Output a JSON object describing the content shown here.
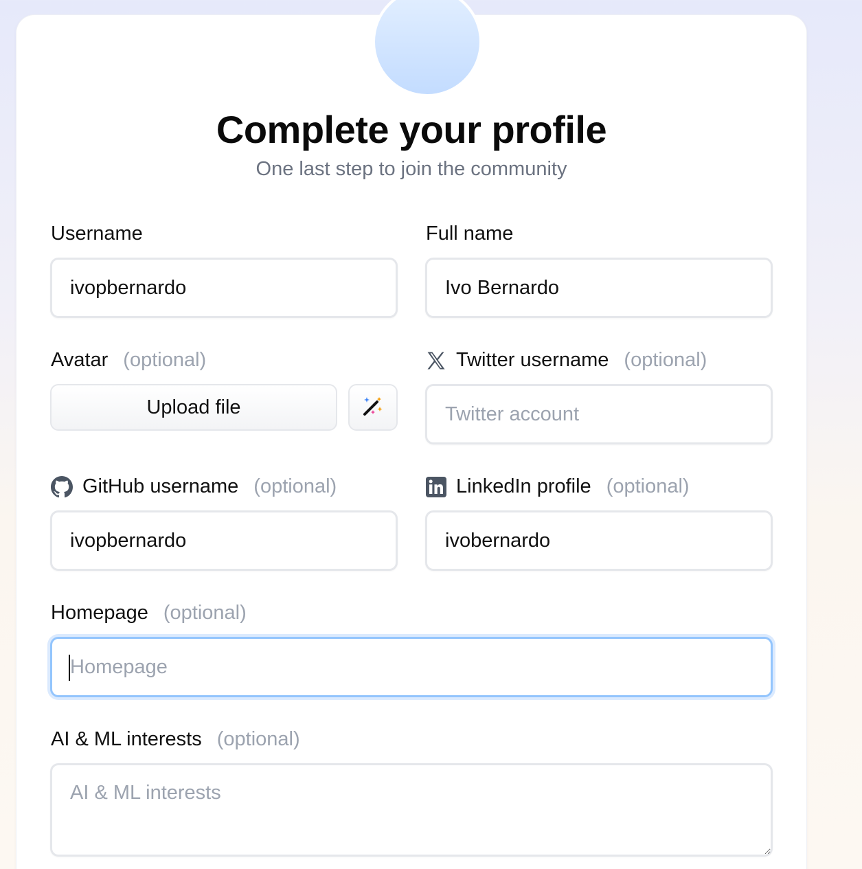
{
  "header": {
    "title": "Complete your profile",
    "subtitle": "One last step to join the community"
  },
  "form": {
    "optional_tag": "(optional)",
    "username": {
      "label": "Username",
      "value": "ivopbernardo"
    },
    "full_name": {
      "label": "Full name",
      "value": "Ivo Bernardo"
    },
    "avatar": {
      "label": "Avatar",
      "upload_label": "Upload file",
      "magic_icon": "magic-wand-icon"
    },
    "twitter": {
      "label": "Twitter username",
      "value": "",
      "placeholder": "Twitter account",
      "icon": "x-logo-icon"
    },
    "github": {
      "label": "GitHub username",
      "value": "ivopbernardo",
      "icon": "github-icon"
    },
    "linkedin": {
      "label": "LinkedIn profile",
      "value": "ivobernardo",
      "icon": "linkedin-icon"
    },
    "homepage": {
      "label": "Homepage",
      "value": "",
      "placeholder": "Homepage",
      "focused": true
    },
    "interests": {
      "label": "AI & ML interests",
      "value": "",
      "placeholder": "AI & ML interests"
    }
  },
  "colors": {
    "focus_border": "#93c5fd",
    "placeholder": "#9ca3af",
    "subtitle": "#6b7280"
  }
}
